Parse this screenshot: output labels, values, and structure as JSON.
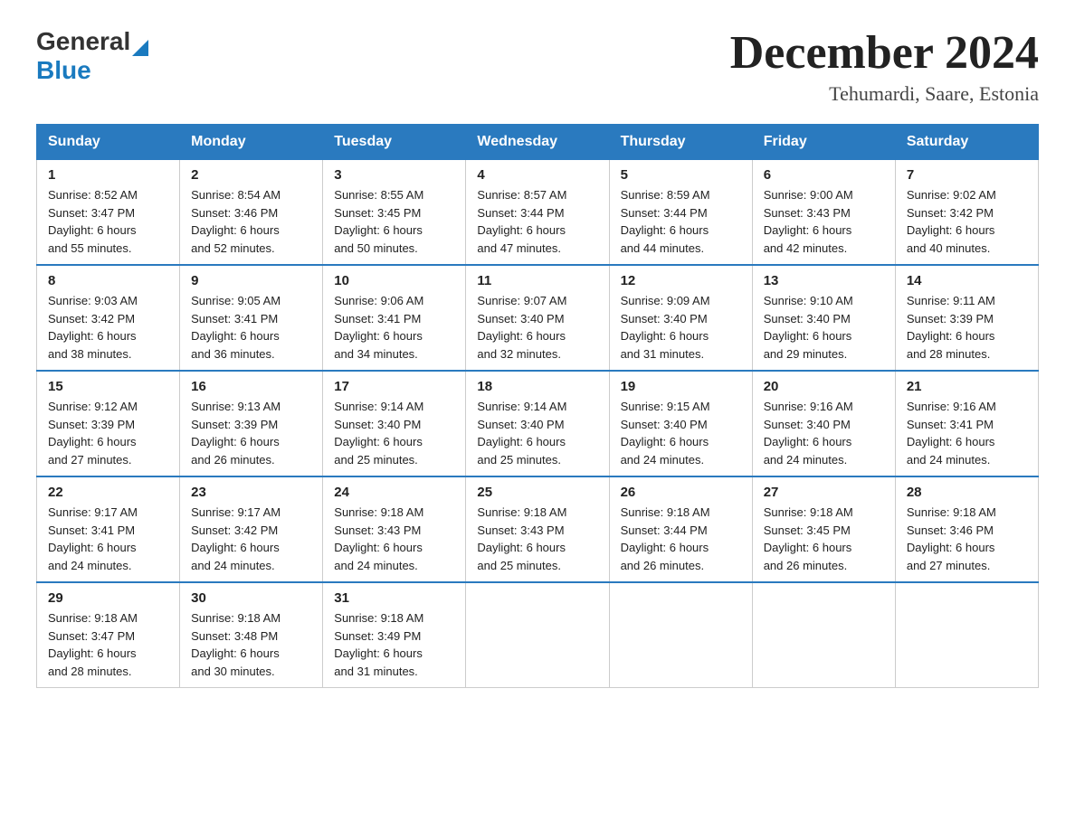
{
  "logo": {
    "general": "General",
    "blue": "Blue",
    "triangle": "▶"
  },
  "header": {
    "month_year": "December 2024",
    "location": "Tehumardi, Saare, Estonia"
  },
  "columns": [
    "Sunday",
    "Monday",
    "Tuesday",
    "Wednesday",
    "Thursday",
    "Friday",
    "Saturday"
  ],
  "weeks": [
    [
      {
        "day": "1",
        "sunrise": "8:52 AM",
        "sunset": "3:47 PM",
        "daylight": "6 hours and 55 minutes."
      },
      {
        "day": "2",
        "sunrise": "8:54 AM",
        "sunset": "3:46 PM",
        "daylight": "6 hours and 52 minutes."
      },
      {
        "day": "3",
        "sunrise": "8:55 AM",
        "sunset": "3:45 PM",
        "daylight": "6 hours and 50 minutes."
      },
      {
        "day": "4",
        "sunrise": "8:57 AM",
        "sunset": "3:44 PM",
        "daylight": "6 hours and 47 minutes."
      },
      {
        "day": "5",
        "sunrise": "8:59 AM",
        "sunset": "3:44 PM",
        "daylight": "6 hours and 44 minutes."
      },
      {
        "day": "6",
        "sunrise": "9:00 AM",
        "sunset": "3:43 PM",
        "daylight": "6 hours and 42 minutes."
      },
      {
        "day": "7",
        "sunrise": "9:02 AM",
        "sunset": "3:42 PM",
        "daylight": "6 hours and 40 minutes."
      }
    ],
    [
      {
        "day": "8",
        "sunrise": "9:03 AM",
        "sunset": "3:42 PM",
        "daylight": "6 hours and 38 minutes."
      },
      {
        "day": "9",
        "sunrise": "9:05 AM",
        "sunset": "3:41 PM",
        "daylight": "6 hours and 36 minutes."
      },
      {
        "day": "10",
        "sunrise": "9:06 AM",
        "sunset": "3:41 PM",
        "daylight": "6 hours and 34 minutes."
      },
      {
        "day": "11",
        "sunrise": "9:07 AM",
        "sunset": "3:40 PM",
        "daylight": "6 hours and 32 minutes."
      },
      {
        "day": "12",
        "sunrise": "9:09 AM",
        "sunset": "3:40 PM",
        "daylight": "6 hours and 31 minutes."
      },
      {
        "day": "13",
        "sunrise": "9:10 AM",
        "sunset": "3:40 PM",
        "daylight": "6 hours and 29 minutes."
      },
      {
        "day": "14",
        "sunrise": "9:11 AM",
        "sunset": "3:39 PM",
        "daylight": "6 hours and 28 minutes."
      }
    ],
    [
      {
        "day": "15",
        "sunrise": "9:12 AM",
        "sunset": "3:39 PM",
        "daylight": "6 hours and 27 minutes."
      },
      {
        "day": "16",
        "sunrise": "9:13 AM",
        "sunset": "3:39 PM",
        "daylight": "6 hours and 26 minutes."
      },
      {
        "day": "17",
        "sunrise": "9:14 AM",
        "sunset": "3:40 PM",
        "daylight": "6 hours and 25 minutes."
      },
      {
        "day": "18",
        "sunrise": "9:14 AM",
        "sunset": "3:40 PM",
        "daylight": "6 hours and 25 minutes."
      },
      {
        "day": "19",
        "sunrise": "9:15 AM",
        "sunset": "3:40 PM",
        "daylight": "6 hours and 24 minutes."
      },
      {
        "day": "20",
        "sunrise": "9:16 AM",
        "sunset": "3:40 PM",
        "daylight": "6 hours and 24 minutes."
      },
      {
        "day": "21",
        "sunrise": "9:16 AM",
        "sunset": "3:41 PM",
        "daylight": "6 hours and 24 minutes."
      }
    ],
    [
      {
        "day": "22",
        "sunrise": "9:17 AM",
        "sunset": "3:41 PM",
        "daylight": "6 hours and 24 minutes."
      },
      {
        "day": "23",
        "sunrise": "9:17 AM",
        "sunset": "3:42 PM",
        "daylight": "6 hours and 24 minutes."
      },
      {
        "day": "24",
        "sunrise": "9:18 AM",
        "sunset": "3:43 PM",
        "daylight": "6 hours and 24 minutes."
      },
      {
        "day": "25",
        "sunrise": "9:18 AM",
        "sunset": "3:43 PM",
        "daylight": "6 hours and 25 minutes."
      },
      {
        "day": "26",
        "sunrise": "9:18 AM",
        "sunset": "3:44 PM",
        "daylight": "6 hours and 26 minutes."
      },
      {
        "day": "27",
        "sunrise": "9:18 AM",
        "sunset": "3:45 PM",
        "daylight": "6 hours and 26 minutes."
      },
      {
        "day": "28",
        "sunrise": "9:18 AM",
        "sunset": "3:46 PM",
        "daylight": "6 hours and 27 minutes."
      }
    ],
    [
      {
        "day": "29",
        "sunrise": "9:18 AM",
        "sunset": "3:47 PM",
        "daylight": "6 hours and 28 minutes."
      },
      {
        "day": "30",
        "sunrise": "9:18 AM",
        "sunset": "3:48 PM",
        "daylight": "6 hours and 30 minutes."
      },
      {
        "day": "31",
        "sunrise": "9:18 AM",
        "sunset": "3:49 PM",
        "daylight": "6 hours and 31 minutes."
      },
      null,
      null,
      null,
      null
    ]
  ]
}
